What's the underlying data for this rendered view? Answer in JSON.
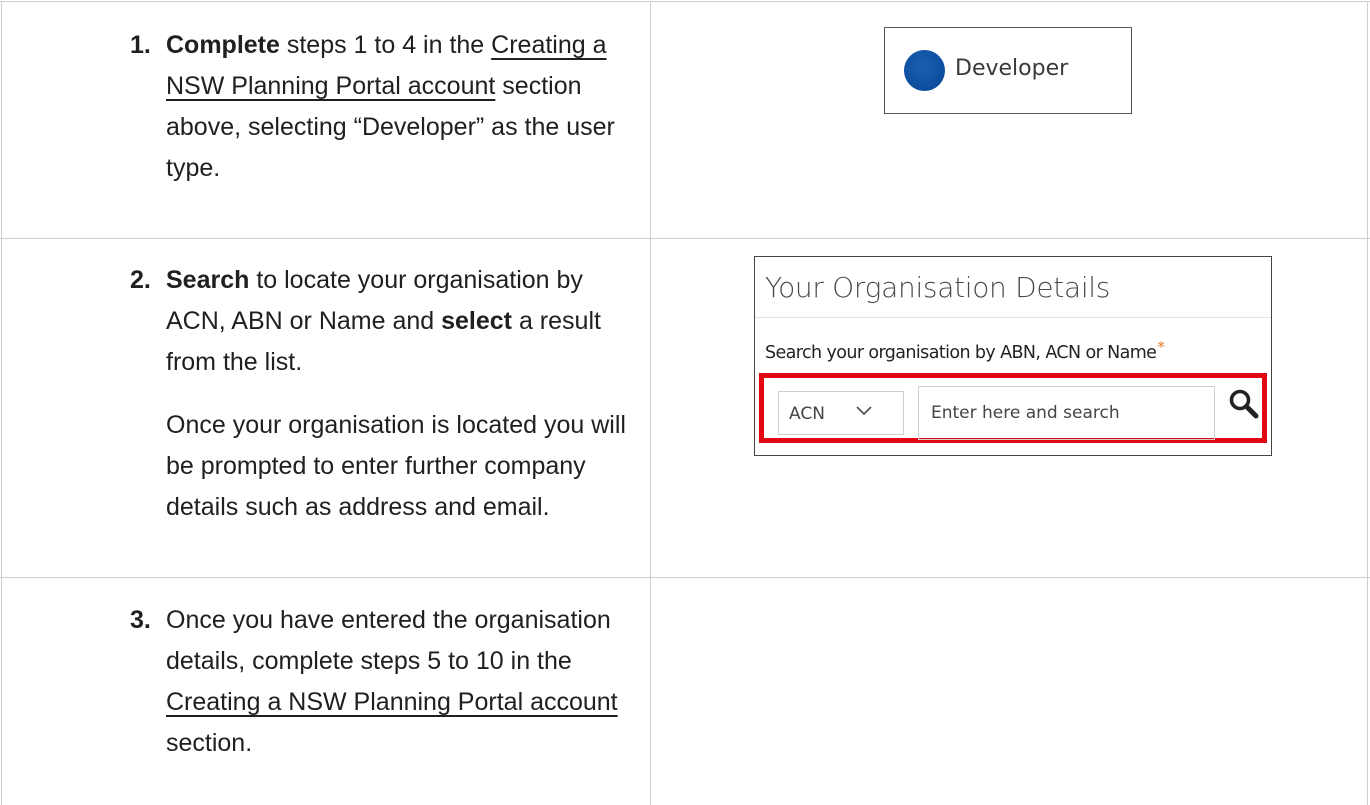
{
  "steps": [
    {
      "number": "1.",
      "bold_word": "Complete",
      "text_a": " steps 1 to 4 in the ",
      "link": "Creating a NSW Planning Portal account",
      "text_b": " section above, selecting “Developer” as the user type."
    },
    {
      "number": "2.",
      "bold_word": "Search",
      "text_a": " to locate your organisation by ACN, ABN or Name and ",
      "bold_word_2": "select",
      "text_b": " a result from the list.",
      "paragraph_2": "Once your organisation is located you will be prompted to enter further company details such as address and email."
    },
    {
      "number": "3.",
      "text_a": "Once you have entered the organisation details, complete steps 5 to 10 in the ",
      "link": "Creating a NSW Planning Portal account",
      "text_b": " section."
    }
  ],
  "user_type_option": {
    "label": "Developer",
    "selected_color": "#0d4d9e"
  },
  "org_details": {
    "title": "Your Organisation Details",
    "prompt": "Search your organisation by ABN, ACN or Name",
    "required_mark": "*",
    "search_type_value": "ACN",
    "search_placeholder": "Enter here and search",
    "highlight_color": "#e30613"
  }
}
